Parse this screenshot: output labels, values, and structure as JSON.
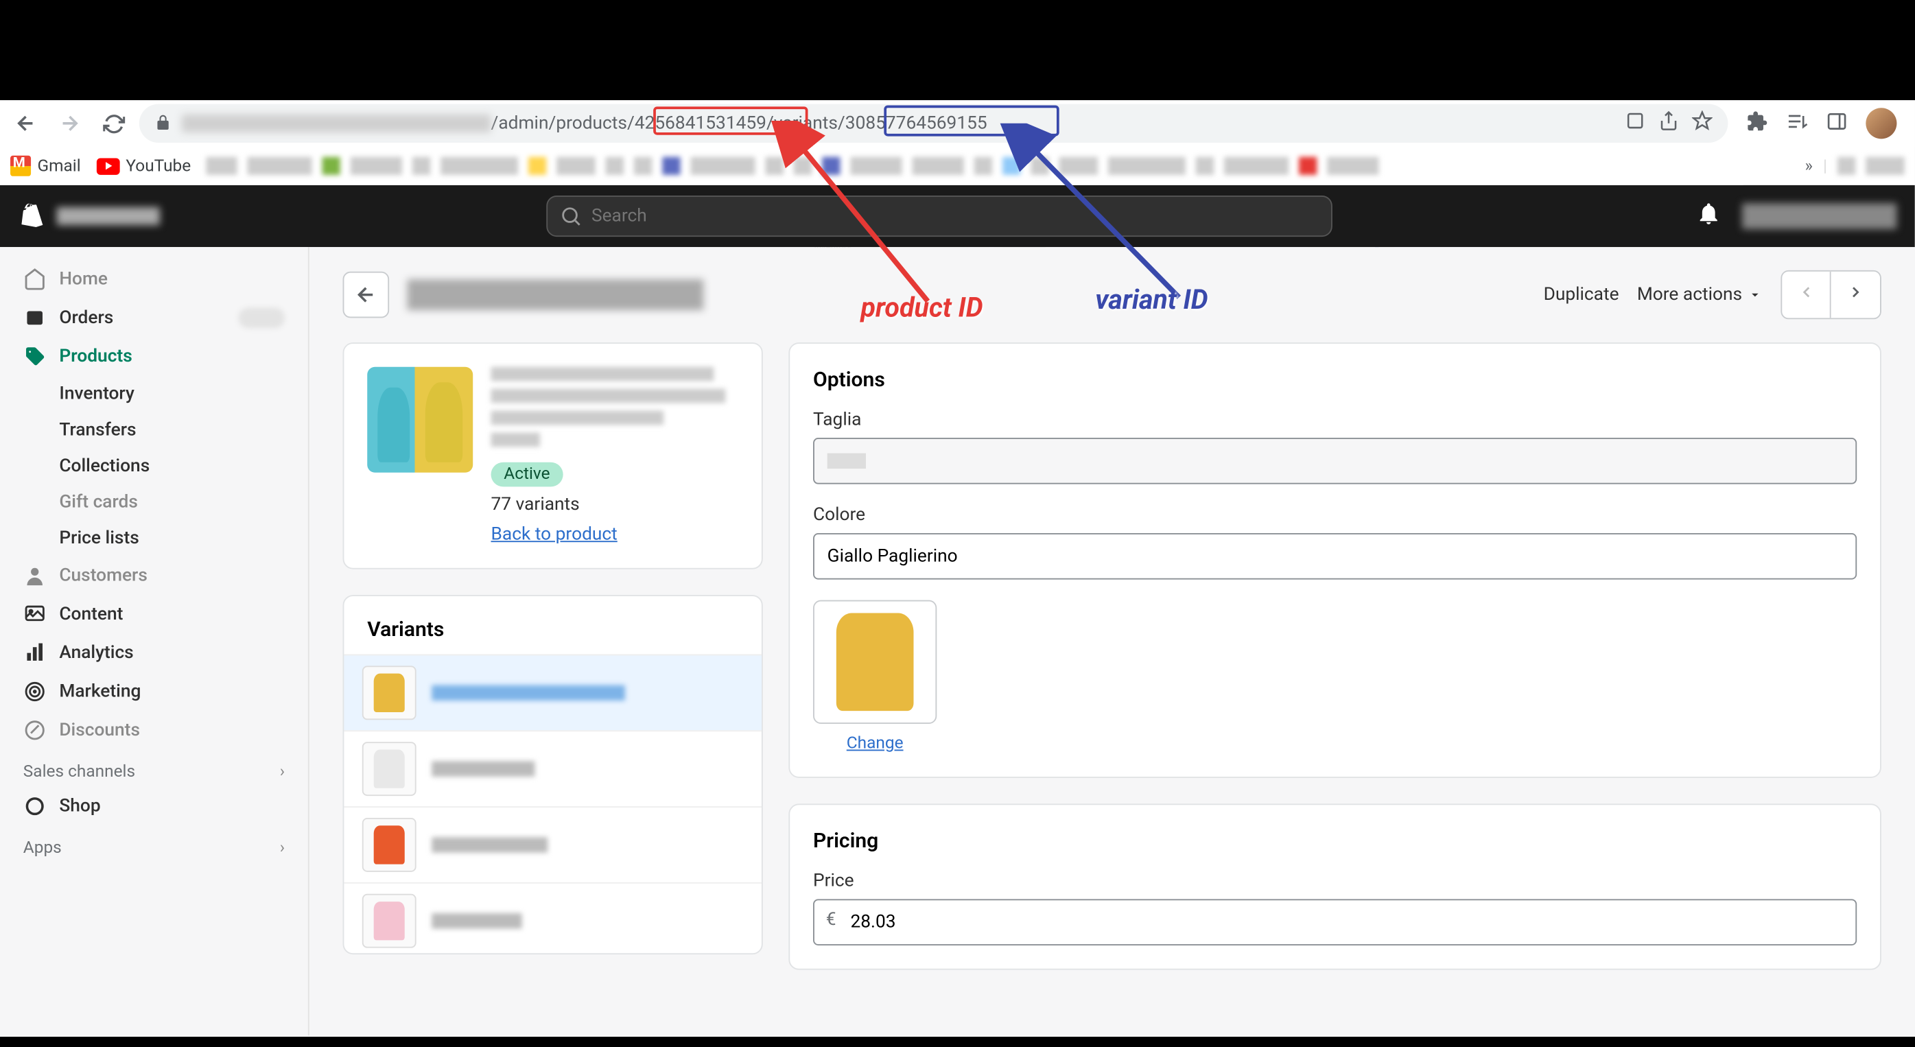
{
  "browser": {
    "url_prefix": "/admin/products/",
    "product_id": "4256841531459",
    "url_mid": "/variants/",
    "variant_id": "30857764569155",
    "bookmarks": {
      "gmail": "Gmail",
      "youtube": "YouTube"
    }
  },
  "shopify_header": {
    "search_placeholder": "Search"
  },
  "sidebar": {
    "home": "Home",
    "orders": "Orders",
    "products": "Products",
    "inventory": "Inventory",
    "transfers": "Transfers",
    "collections": "Collections",
    "gift_cards": "Gift cards",
    "price_lists": "Price lists",
    "customers": "Customers",
    "content": "Content",
    "analytics": "Analytics",
    "marketing": "Marketing",
    "discounts": "Discounts",
    "sales_channels": "Sales channels",
    "shop": "Shop",
    "apps": "Apps"
  },
  "page": {
    "duplicate": "Duplicate",
    "more_actions": "More actions",
    "product_card": {
      "status": "Active",
      "variants_count": "77 variants",
      "back_link": "Back to product"
    },
    "variants_card": {
      "title": "Variants"
    },
    "options_card": {
      "title": "Options",
      "size_label": "Taglia",
      "size_value": "",
      "color_label": "Colore",
      "color_value": "Giallo Paglierino",
      "change_link": "Change"
    },
    "pricing_card": {
      "title": "Pricing",
      "price_label": "Price",
      "currency": "€",
      "price_value": "28.03"
    }
  },
  "annotations": {
    "product_id_label": "product ID",
    "variant_id_label": "variant ID"
  }
}
